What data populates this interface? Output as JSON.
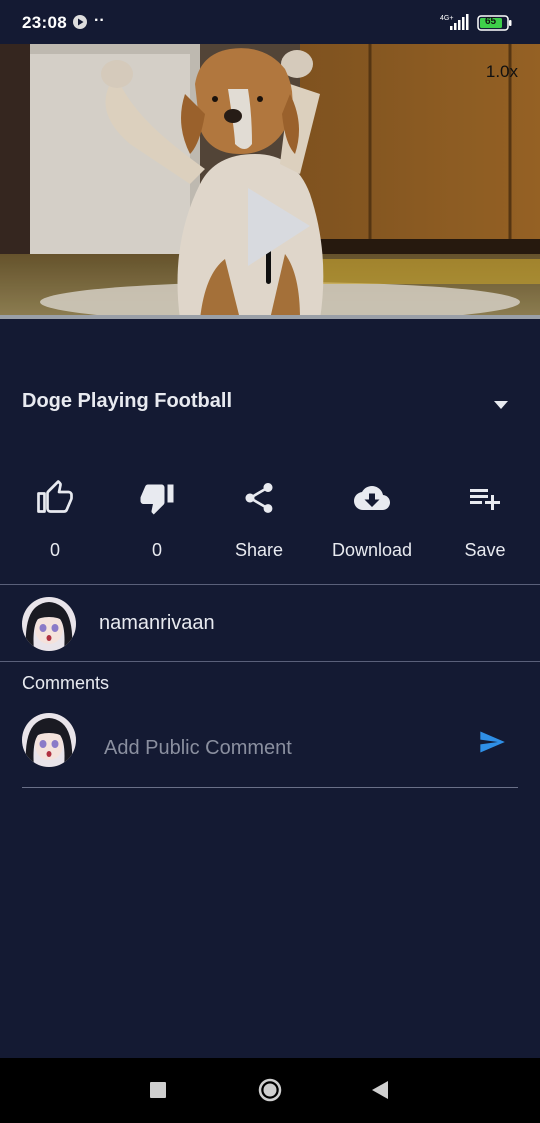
{
  "status_bar": {
    "time": "23:08",
    "network": "4G+",
    "battery": "65"
  },
  "player": {
    "speed": "1.0x",
    "play_icon": "play-icon"
  },
  "video": {
    "title": "Doge Playing Football"
  },
  "actions": [
    {
      "icon": "thumbs-up-icon",
      "label": "0"
    },
    {
      "icon": "thumbs-down-icon",
      "label": "0"
    },
    {
      "icon": "share-icon",
      "label": "Share"
    },
    {
      "icon": "download-cloud-icon",
      "label": "Download"
    },
    {
      "icon": "playlist-add-icon",
      "label": "Save"
    }
  ],
  "channel": {
    "name": "namanrivaan"
  },
  "comments": {
    "heading": "Comments",
    "placeholder": "Add Public Comment"
  },
  "colors": {
    "background": "#141a33",
    "accent": "#2f8fe6",
    "text": "#e8eaf0"
  }
}
